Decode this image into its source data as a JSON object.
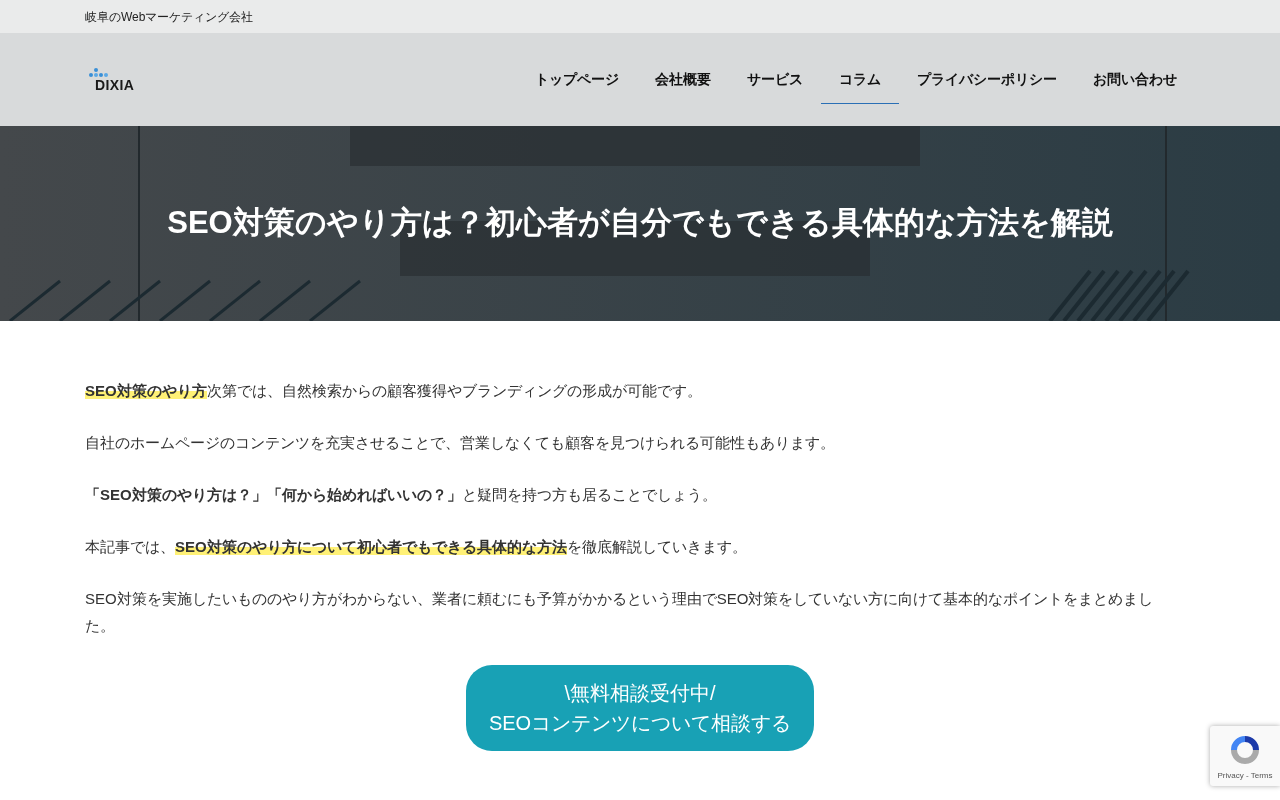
{
  "top_bar": {
    "tagline": "岐阜のWebマーケティング会社"
  },
  "header": {
    "logo": "DIXIA",
    "nav": [
      {
        "label": "トップページ",
        "selected": false
      },
      {
        "label": "会社概要",
        "selected": false
      },
      {
        "label": "サービス",
        "selected": false
      },
      {
        "label": "コラム",
        "selected": true
      },
      {
        "label": "プライバシーポリシー",
        "selected": false
      },
      {
        "label": "お問い合わせ",
        "selected": false
      }
    ]
  },
  "hero": {
    "kind": "picture",
    "title": "SEO対策のやり方は？初心者が自分でもできる具体的な方法を解説"
  },
  "paragraphs": [
    {
      "segments": [
        {
          "text": "**SEO対策のやり方**",
          "highlighted": true
        },
        {
          "text": "次第では、自然検索からの顧客獲得やブランディングの形成が可能です。",
          "highlighted": false
        }
      ]
    },
    {
      "segments": [
        {
          "text": "自社のホームページのコンテンツを充実させることで、営業しなくても顧客を見つけられる可能性もあります。",
          "highlighted": false
        }
      ]
    },
    {
      "segments": [
        {
          "text": "**「SEO対策のやり方は？」「何から始めればいいの？」**",
          "highlighted": false
        },
        {
          "text": "と疑問を持つ方も居ることでしょう。",
          "highlighted": false
        }
      ]
    },
    {
      "segments": [
        {
          "text": "本記事では、",
          "highlighted": false
        },
        {
          "text": "**SEO対策のやり方について初心者でもできる具体的な方法**",
          "highlighted": true
        },
        {
          "text": "を徹底解説していきます。",
          "highlighted": false
        }
      ]
    },
    {
      "segments": [
        {
          "text": "SEO対策を実施したいもののやり方がわからない、業者に頼むにも予算がかかるという理由でSEO対策をしていない方に向けて基本的なポイントをまとめました。",
          "highlighted": false
        }
      ]
    }
  ],
  "cta_button": {
    "lines": [
      "\\無料相談受付中/",
      "SEOコンテンツについて相談する"
    ]
  },
  "recaptcha": {
    "links": "Privacy - Terms"
  }
}
